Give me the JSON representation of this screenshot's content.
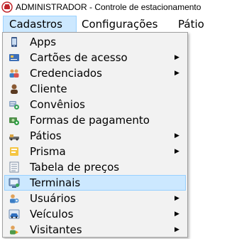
{
  "window": {
    "title": "ADMINISTRADOR - Controle de estacionamento",
    "icon": "app-logo-icon"
  },
  "menubar": {
    "items": [
      {
        "label": "Cadastros",
        "state": "open"
      },
      {
        "label": "Configurações"
      },
      {
        "label": "Pátio"
      }
    ]
  },
  "dropdown": {
    "selected": "Terminais",
    "items": [
      {
        "label": "Apps",
        "icon": "mobile-phone-icon",
        "submenu": false
      },
      {
        "label": "Cartões de acesso",
        "icon": "access-card-icon",
        "submenu": true
      },
      {
        "label": "Credenciados",
        "icon": "users-group-icon",
        "submenu": true
      },
      {
        "label": "Cliente",
        "icon": "person-icon",
        "submenu": false
      },
      {
        "label": "Convênios",
        "icon": "agreement-icon",
        "submenu": false
      },
      {
        "label": "Formas de pagamento",
        "icon": "payment-icon",
        "submenu": false
      },
      {
        "label": "Pátios",
        "icon": "parking-lot-icon",
        "submenu": true
      },
      {
        "label": "Prisma",
        "icon": "prism-icon",
        "submenu": true
      },
      {
        "label": "Tabela de preços",
        "icon": "price-table-icon",
        "submenu": false
      },
      {
        "label": "Terminais",
        "icon": "terminal-icon",
        "submenu": false
      },
      {
        "label": "Usuários",
        "icon": "users-icon",
        "submenu": true
      },
      {
        "label": "Veículos",
        "icon": "car-icon",
        "submenu": true
      },
      {
        "label": "Visitantes",
        "icon": "visitor-icon",
        "submenu": true
      }
    ]
  },
  "colors": {
    "highlight": "#cce8ff",
    "highlight_border": "#99d1ff",
    "menu_bg": "#f2f2f2"
  }
}
